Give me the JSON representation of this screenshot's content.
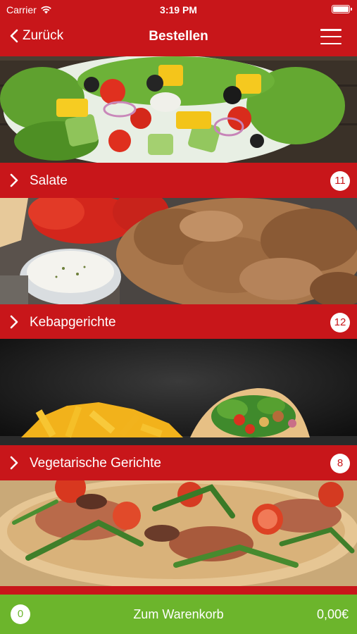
{
  "status": {
    "carrier": "Carrier",
    "time": "3:19 PM"
  },
  "nav": {
    "back_label": "Zurück",
    "title": "Bestellen"
  },
  "categories": [
    {
      "label": "Salate",
      "count": "11"
    },
    {
      "label": "Kebapgerichte",
      "count": "12"
    },
    {
      "label": "Vegetarische Gerichte",
      "count": "8"
    }
  ],
  "cart": {
    "count": "0",
    "label": "Zum Warenkorb",
    "total": "0,00€"
  },
  "colors": {
    "primary": "#c8161a",
    "cart": "#6cb52c"
  }
}
